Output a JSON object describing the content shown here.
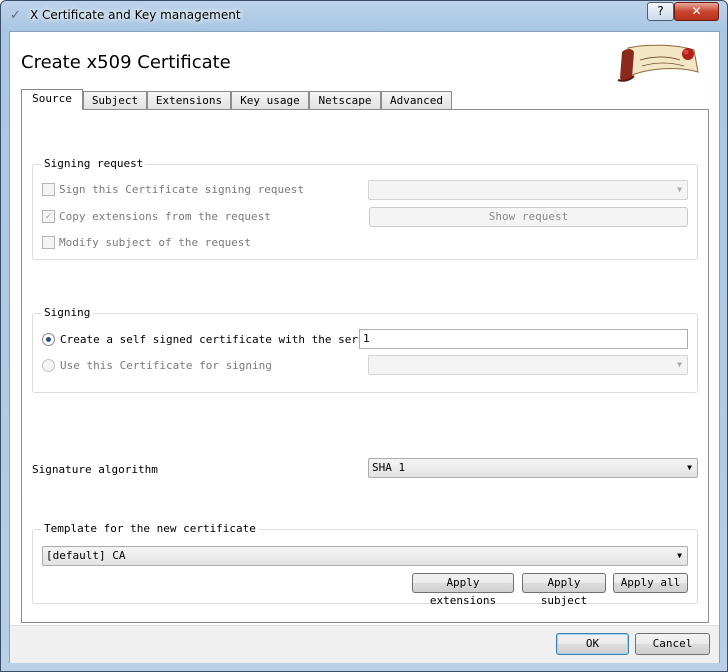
{
  "window": {
    "title": "X Certificate and Key management",
    "help_label": "?",
    "close_label": "✕"
  },
  "page_title": "Create x509 Certificate",
  "tabs": [
    {
      "label": "Source",
      "active": true
    },
    {
      "label": "Subject"
    },
    {
      "label": "Extensions"
    },
    {
      "label": "Key usage"
    },
    {
      "label": "Netscape"
    },
    {
      "label": "Advanced"
    }
  ],
  "signing_request": {
    "title": "Signing request",
    "sign_csr_label": "Sign this Certificate signing request",
    "sign_csr_checked": false,
    "csr_select_value": "",
    "copy_ext_label": "Copy extensions from the request",
    "copy_ext_checked": true,
    "show_request_label": "Show request",
    "modify_subject_label": "Modify subject of the request",
    "modify_subject_checked": false
  },
  "signing": {
    "title": "Signing",
    "self_signed_label": "Create a self signed certificate with the serial",
    "self_signed_selected": true,
    "serial_value": "1",
    "use_cert_label": "Use this Certificate for signing",
    "signer_select_value": ""
  },
  "signature_algorithm": {
    "label": "Signature algorithm",
    "value": "SHA 1"
  },
  "template": {
    "title": "Template for the new certificate",
    "value": "[default] CA",
    "apply_extensions_label": "Apply extensions",
    "apply_subject_label": "Apply subject",
    "apply_all_label": "Apply all"
  },
  "footer": {
    "ok_label": "OK",
    "cancel_label": "Cancel"
  },
  "colors": {
    "title_bar": "#a9c6e3",
    "radio_dot": "#1f4f85",
    "default_button_border": "#3c7fb1",
    "logo_ribbon": "#8b2a1a"
  }
}
